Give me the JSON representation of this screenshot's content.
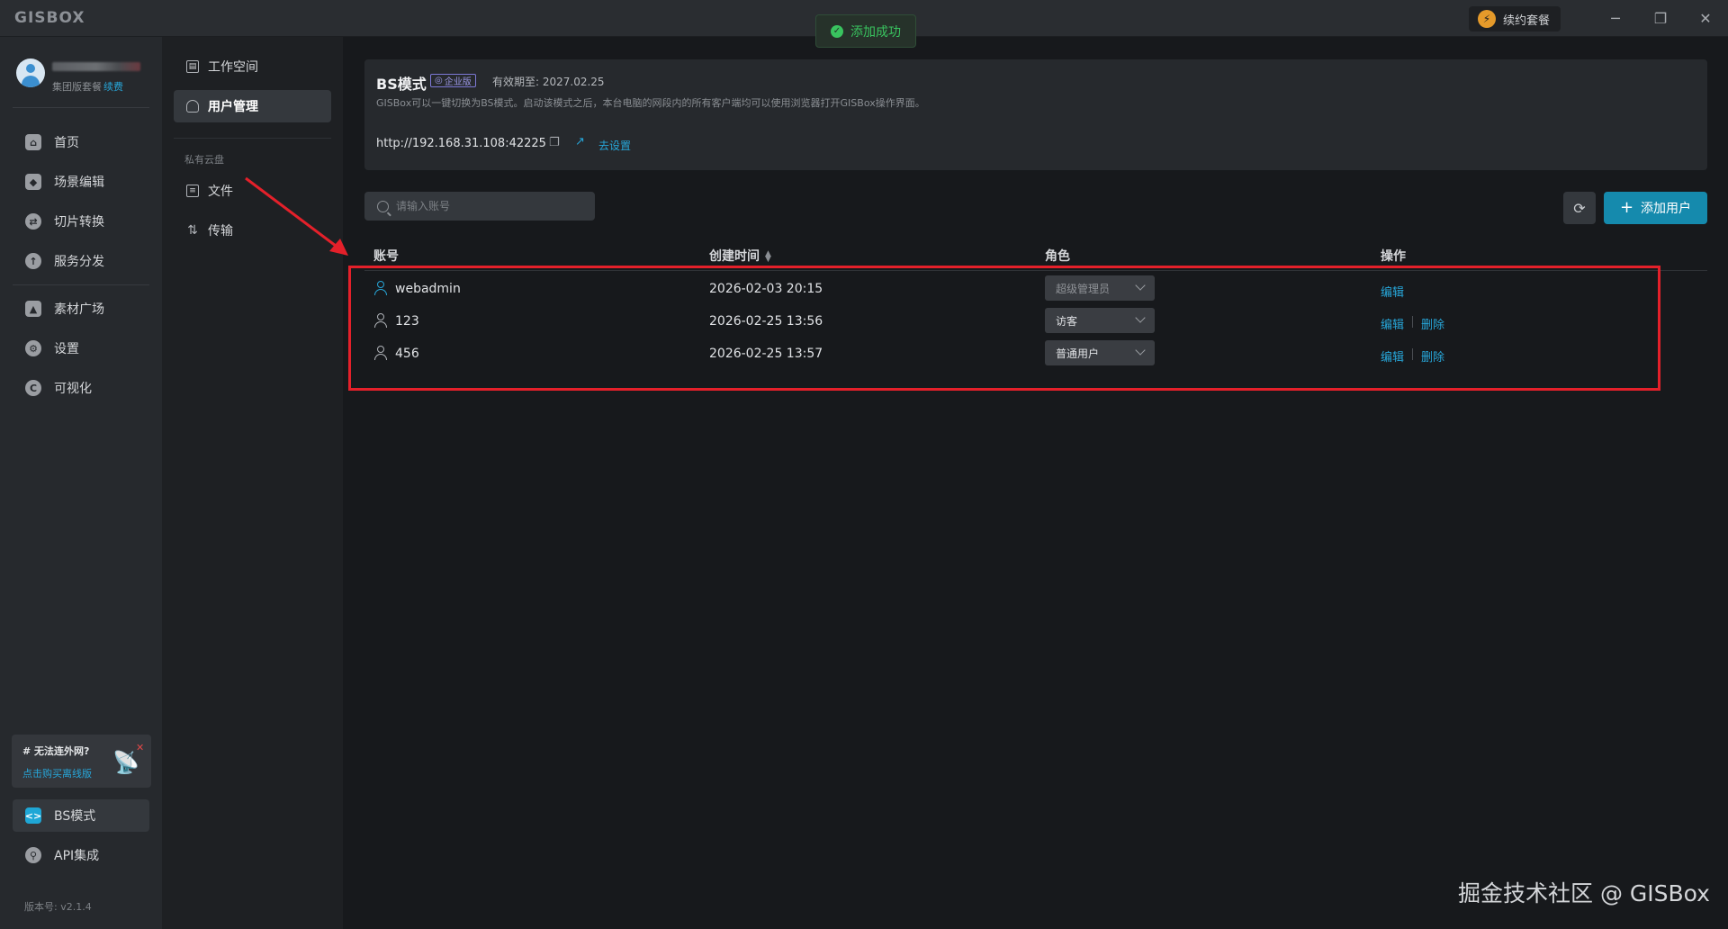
{
  "app": {
    "logo": "GISBOX"
  },
  "toast": {
    "text": "添加成功"
  },
  "titlebar": {
    "renew_label": "续约套餐",
    "renew_icon": "lightning-icon",
    "minimize": "─",
    "restore": "❐",
    "close": "✕"
  },
  "user": {
    "plan": "集团版套餐",
    "renew_link": "续费"
  },
  "sidebar": {
    "items": [
      {
        "label": "首页",
        "icon": "home-icon",
        "glyph": "⌂"
      },
      {
        "label": "场景编辑",
        "icon": "cube-icon",
        "glyph": "◆"
      },
      {
        "label": "切片转换",
        "icon": "convert-icon",
        "glyph": "⇄"
      },
      {
        "label": "服务分发",
        "icon": "upload-icon",
        "glyph": "↑"
      },
      {
        "label": "素材广场",
        "icon": "image-icon",
        "glyph": "▲"
      },
      {
        "label": "设置",
        "icon": "gear-icon",
        "glyph": "⚙"
      },
      {
        "label": "可视化",
        "icon": "chart-icon",
        "glyph": "C"
      }
    ],
    "offline_card": {
      "title": "# 无法连外网?",
      "link": "点击购买离线版"
    },
    "bottom_items": [
      {
        "label": "BS模式",
        "icon": "code-icon",
        "glyph": "<>"
      },
      {
        "label": "API集成",
        "icon": "api-icon",
        "glyph": "⚲"
      }
    ],
    "version": "版本号: v2.1.4"
  },
  "subnav": {
    "items": [
      {
        "label": "工作空间"
      },
      {
        "label": "用户管理"
      }
    ],
    "section_title": "私有云盘",
    "cloud_items": [
      {
        "label": "文件"
      },
      {
        "label": "传输"
      }
    ]
  },
  "bs_card": {
    "title": "BS模式",
    "badge": "企业版",
    "expiry": "有效期至: 2027.02.25",
    "description": "GISBox可以一键切换为BS模式。启动该模式之后，本台电脑的网段内的所有客户端均可以使用浏览器打开GISBox操作界面。",
    "url": "http://192.168.31.108:42225",
    "goto_label": "去设置"
  },
  "search": {
    "placeholder": "请输入账号"
  },
  "add_user_label": "添加用户",
  "table": {
    "headers": {
      "account": "账号",
      "created": "创建时间",
      "role": "角色",
      "actions": "操作"
    },
    "rows": [
      {
        "account": "webadmin",
        "created": "2026-02-03 20:15",
        "role": "超级管理员",
        "edit": "编辑"
      },
      {
        "account": "123",
        "created": "2026-02-25 13:56",
        "role": "访客",
        "edit": "编辑",
        "delete": "删除"
      },
      {
        "account": "456",
        "created": "2026-02-25 13:57",
        "role": "普通用户",
        "edit": "编辑",
        "delete": "删除"
      }
    ]
  },
  "watermark": "掘金技术社区 @ GISBox",
  "colors": {
    "accent": "#27a6d9",
    "primary_button": "#158aad",
    "success": "#39c35f",
    "highlight": "#e4202a"
  }
}
